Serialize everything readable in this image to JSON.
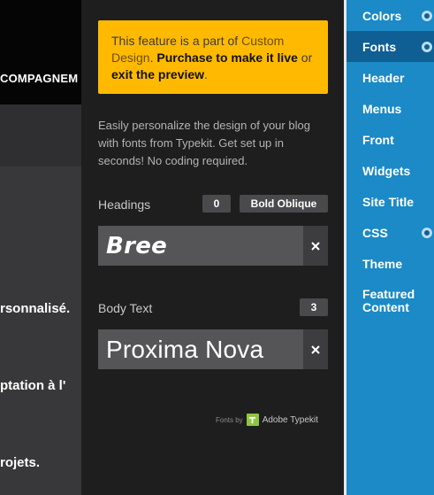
{
  "background": {
    "nav_label": "COMPAGNEM",
    "lines": [
      "rsonnalisé.",
      "ptation à l'",
      "rojets."
    ]
  },
  "panel": {
    "notice": {
      "text_before": "This feature is a part of ",
      "link_custom_design": "Custom Design",
      "text_mid": ". ",
      "link_purchase": "Purchase to make it live",
      "text_or": " or ",
      "link_exit": "exit the preview",
      "text_end": "."
    },
    "intro": "Easily personalize the design of your blog with fonts from Typekit. Get set up in seconds! No coding required.",
    "headings": {
      "label": "Headings",
      "count": "0",
      "style": "Bold Oblique",
      "font_name": "Bree"
    },
    "body_text": {
      "label": "Body Text",
      "count": "3",
      "font_name": "Proxima Nova"
    },
    "credit": {
      "fonts_by": "Fonts by",
      "provider": "Adobe Typekit"
    }
  },
  "sidebar": {
    "items": [
      {
        "label": "Colors",
        "has_dot": true
      },
      {
        "label": "Fonts",
        "has_dot": true,
        "active": true
      },
      {
        "label": "Header"
      },
      {
        "label": "Menus"
      },
      {
        "label": "Front"
      },
      {
        "label": "Widgets"
      },
      {
        "label": "Site Title"
      },
      {
        "label": "CSS",
        "has_dot": true
      },
      {
        "label": "Theme"
      },
      {
        "label": "Featured Content"
      }
    ]
  },
  "colors": {
    "accent_blue": "#1b8ac6",
    "active_blue": "#0f5f94",
    "notice_yellow": "#ffba00",
    "typekit_green": "#8dc63f"
  },
  "icons": [
    "close-icon",
    "typekit-logo-icon",
    "indicator-dot-icon"
  ]
}
